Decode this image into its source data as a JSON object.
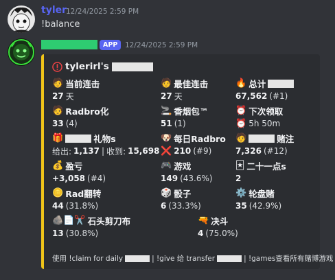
{
  "messages": [
    {
      "username": "tyler",
      "username_color": "#5865f2",
      "timestamp": "12/24/2025 2:59 PM",
      "text": "!balance",
      "avatar_icon": "cartoon-face-avatar"
    },
    {
      "badge": "APP",
      "timestamp": "12/24/2025 2:59 PM",
      "avatar_icon": "green-bot-avatar"
    }
  ],
  "embed": {
    "accent_color": "#f0c419",
    "title_icon": "exclamation-circle-icon",
    "title_prefix": "tylerirl's",
    "fields": [
      {
        "icon": "person-icon",
        "emoji": "🧑",
        "name": "当前连击",
        "value": "27",
        "suffix": "天"
      },
      {
        "icon": "person-icon",
        "emoji": "🧑",
        "name": "最佳连击",
        "value": "27",
        "suffix": "天"
      },
      {
        "icon": "fire-icon",
        "emoji": "🔥",
        "name": "总计",
        "value": "67,562",
        "suffix": "(#1)"
      },
      {
        "icon": "person-icon",
        "emoji": "🧑",
        "name": "Radbro化",
        "value": "33",
        "suffix": "(4)"
      },
      {
        "icon": "cigarette-icon",
        "emoji": "🚬",
        "name": "香烟包™",
        "value": "51",
        "suffix": "(1)"
      },
      {
        "icon": "alarm-clock-icon",
        "emoji": "⏰",
        "name": "下次领取",
        "value": "",
        "suffix": "5h 50m"
      },
      {
        "icon": "gift-icon",
        "emoji": "🎁",
        "name": "礼物s",
        "value": "",
        "suffix": ""
      },
      {
        "icon": "dog-icon",
        "emoji": "🐶",
        "name": "每日Radbro",
        "value": "210",
        "suffix": "(#9)"
      },
      {
        "icon": "person-icon",
        "emoji": "🧑",
        "name": "赌注",
        "value": "7,326",
        "suffix": "(#12)"
      },
      {
        "icon": "money-bag-icon",
        "emoji": "💰",
        "name": "盈亏",
        "value": "+3,058",
        "suffix": "(#4)"
      },
      {
        "icon": "game-controller-icon",
        "emoji": "🎮",
        "name": "游戏",
        "value": "149",
        "suffix": "(43.6%)"
      },
      {
        "icon": "playing-card-icon",
        "emoji": "🃏",
        "name": "二十一点s",
        "value": "2",
        "suffix": ""
      },
      {
        "icon": "coin-icon",
        "emoji": "🪙",
        "name": "Rad翻转",
        "value": "44",
        "suffix": "(31.8%)"
      },
      {
        "icon": "dice-icon",
        "emoji": "🎲",
        "name": "骰子",
        "value": "6",
        "suffix": "(33.3%)"
      },
      {
        "icon": "roulette-wheel-icon",
        "emoji": "⚙️",
        "name": "轮盘赌",
        "value": "35",
        "suffix": "(42.9%)"
      },
      {
        "icon": "rock-paper-scissors-icon",
        "emoji": "🪨📄✂️",
        "name": "石头剪刀布",
        "value": "13",
        "suffix": "(30.8%)"
      },
      {
        "icon": "water-pistol-icon",
        "emoji": "🔫",
        "name": "决斗",
        "value": "4",
        "suffix": "(75.0%)"
      }
    ],
    "gifts": {
      "given_label": "给出:",
      "given_value": "1,137",
      "separator": "|",
      "received_label": "收到:",
      "received_value": "15,698"
    },
    "daily_radbro_cross": "❌",
    "next_claim_alarm": "⏰",
    "footer": {
      "part1": "使用 !claim for daily",
      "part2": "| !give 给 transfer",
      "part3": "| !games查看所有赌博游戏"
    }
  }
}
